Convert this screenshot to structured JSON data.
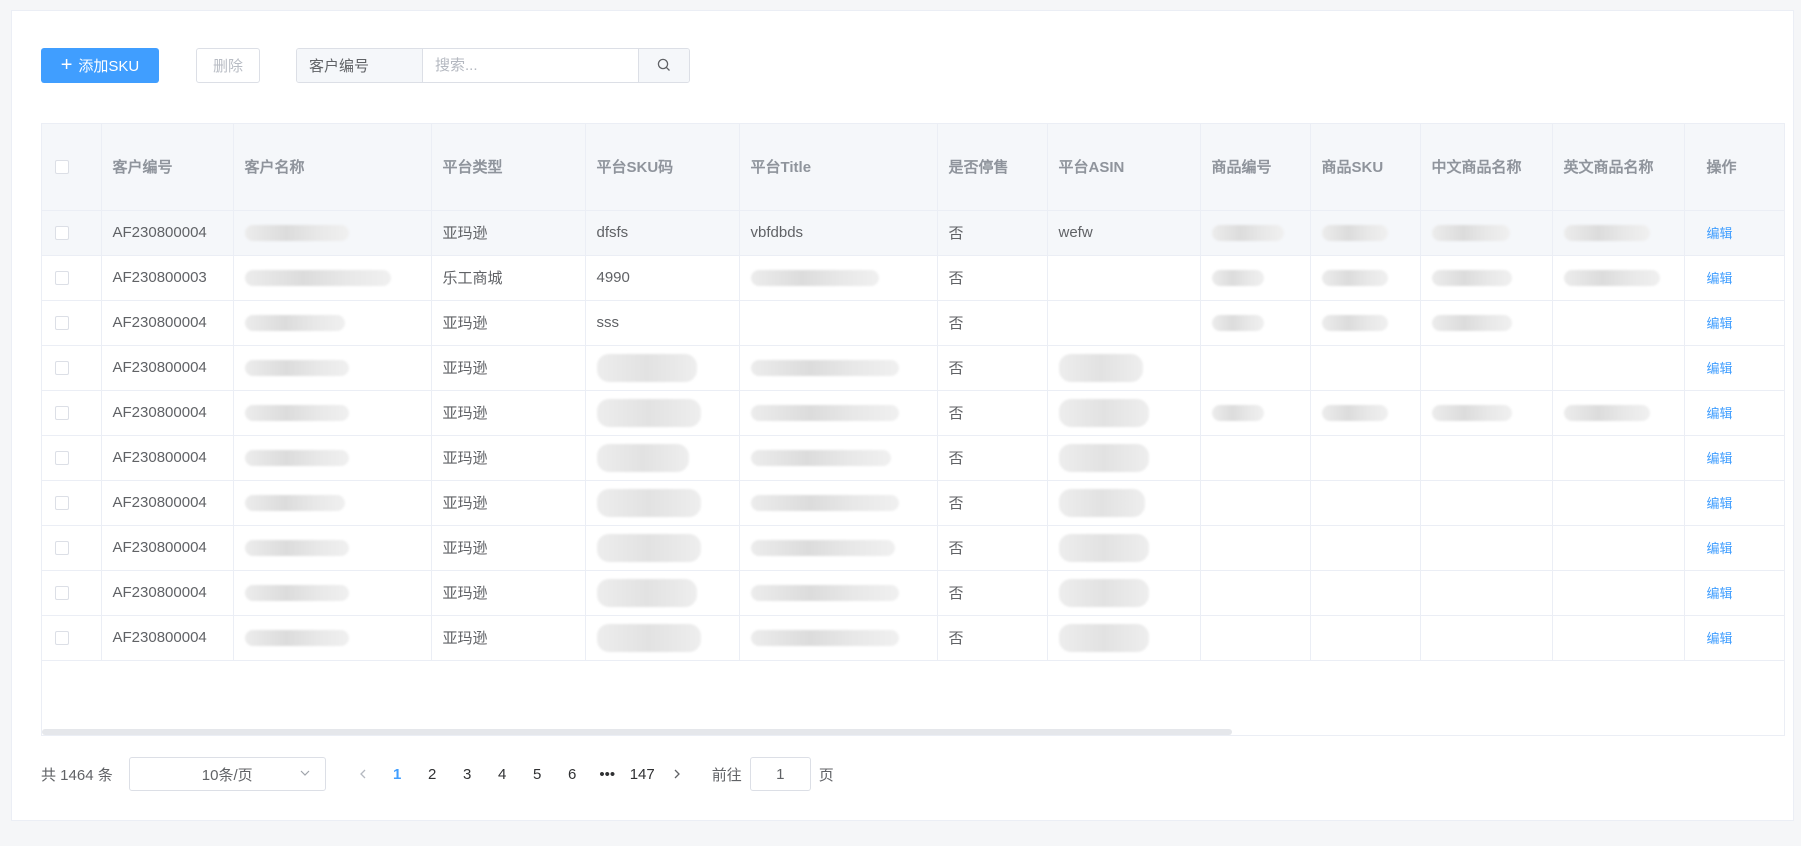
{
  "toolbar": {
    "add_label": "添加SKU",
    "delete_label": "删除",
    "search_field": "客户编号",
    "search_placeholder": "搜索..."
  },
  "table": {
    "columns": [
      "客户编号",
      "客户名称",
      "平台类型",
      "平台SKU码",
      "平台Title",
      "是否停售",
      "平台ASIN",
      "商品编号",
      "商品SKU",
      "中文商品名称",
      "英文商品名称",
      "操作"
    ],
    "edit_label": "编辑",
    "rows": [
      {
        "customer_no": "AF230800004",
        "platform": "亚玛逊",
        "sku": "dfsfs",
        "title": "vbfdbds",
        "stopped": "否",
        "asin": "wefw"
      },
      {
        "customer_no": "AF230800003",
        "platform": "乐工商城",
        "sku": "4990",
        "title": "",
        "stopped": "否",
        "asin": ""
      },
      {
        "customer_no": "AF230800004",
        "platform": "亚玛逊",
        "sku": "sss",
        "title": "",
        "stopped": "否",
        "asin": ""
      },
      {
        "customer_no": "AF230800004",
        "platform": "亚玛逊",
        "sku": "",
        "title": "",
        "stopped": "否",
        "asin": ""
      },
      {
        "customer_no": "AF230800004",
        "platform": "亚玛逊",
        "sku": "",
        "title": "",
        "stopped": "否",
        "asin": ""
      },
      {
        "customer_no": "AF230800004",
        "platform": "亚玛逊",
        "sku": "",
        "title": "",
        "stopped": "否",
        "asin": ""
      },
      {
        "customer_no": "AF230800004",
        "platform": "亚玛逊",
        "sku": "",
        "title": "",
        "stopped": "否",
        "asin": ""
      },
      {
        "customer_no": "AF230800004",
        "platform": "亚玛逊",
        "sku": "",
        "title": "",
        "stopped": "否",
        "asin": ""
      },
      {
        "customer_no": "AF230800004",
        "platform": "亚玛逊",
        "sku": "",
        "title": "",
        "stopped": "否",
        "asin": ""
      },
      {
        "customer_no": "AF230800004",
        "platform": "亚玛逊",
        "sku": "",
        "title": "",
        "stopped": "否",
        "asin": ""
      }
    ]
  },
  "pagination": {
    "total_text": "共 1464 条",
    "page_size": "10条/页",
    "pages": [
      "1",
      "2",
      "3",
      "4",
      "5",
      "6",
      "•••",
      "147"
    ],
    "current": "1",
    "goto_label": "前往",
    "goto_value": "1",
    "page_suffix": "页"
  },
  "colors": {
    "primary": "#409eff",
    "header_bg": "#f5f7fa",
    "border": "#ebeef5"
  }
}
